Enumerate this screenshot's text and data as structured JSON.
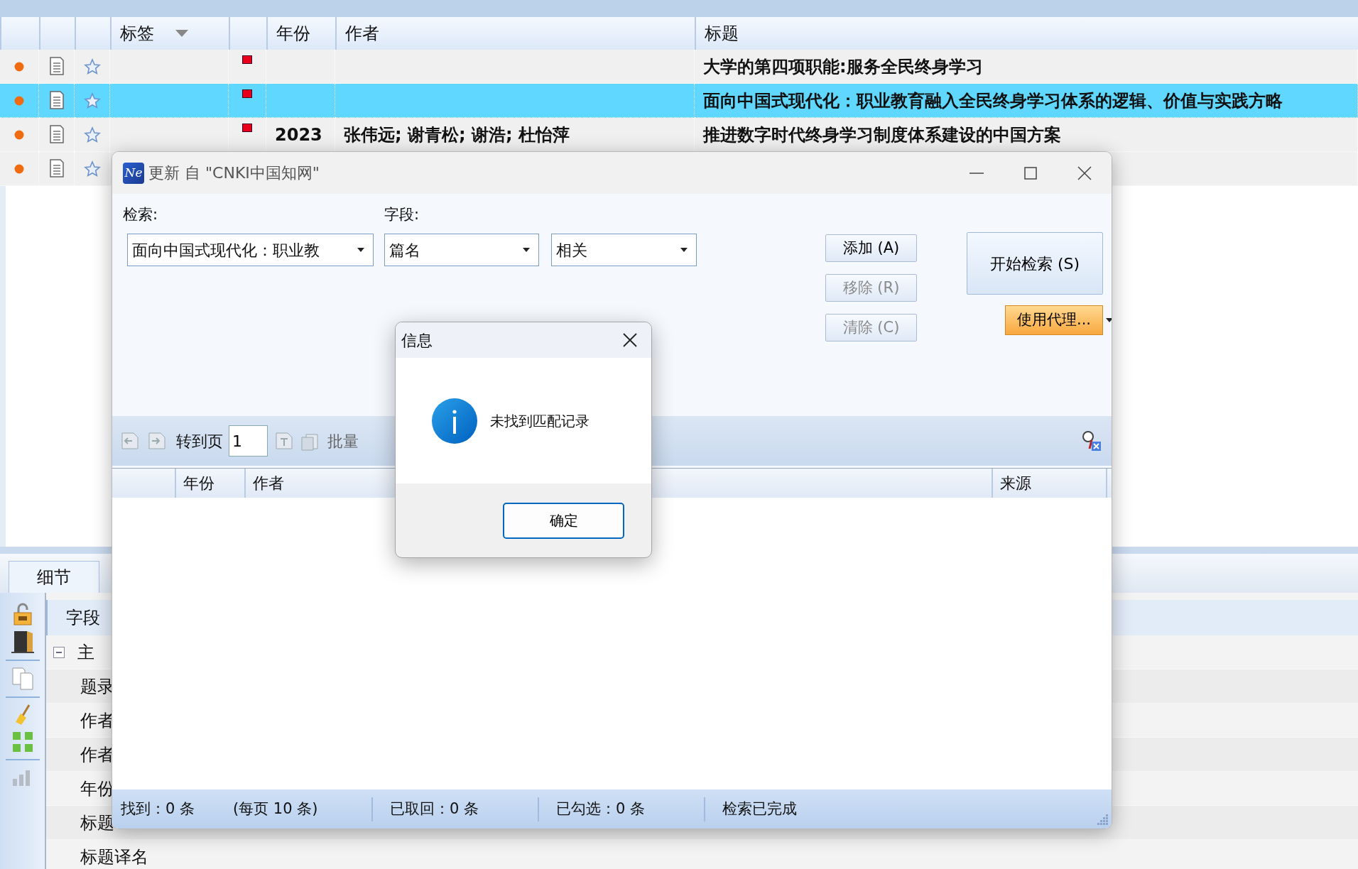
{
  "main_list": {
    "columns": [
      "标签",
      "年份",
      "作者",
      "标题"
    ],
    "rows": [
      {
        "selected": false,
        "flag": true,
        "title": "大学的第四项职能:服务全民终身学习"
      },
      {
        "selected": true,
        "flag": true,
        "title": "面向中国式现代化：职业教育融入全民终身学习体系的逻辑、价值与实践方略"
      },
      {
        "selected": false,
        "flag": true,
        "year": "2023",
        "authors": "张伟远; 谢青松; 谢浩; 杜怡萍",
        "title": "推进数字时代终身学习制度体系建设的中国方案"
      },
      {
        "selected": false
      }
    ]
  },
  "details": {
    "tab": "细节",
    "header": "字段",
    "tree": [
      {
        "label": "主",
        "expanded": true,
        "children": [
          {
            "label": "题录"
          },
          {
            "label": "作者"
          },
          {
            "label": "作者"
          },
          {
            "label": "年份"
          },
          {
            "label": "标题"
          },
          {
            "label": "标题译名"
          }
        ]
      }
    ]
  },
  "search_window": {
    "logo": "Ne",
    "title": "更新 自 \"CNKI中国知网\"",
    "search_label": "检索:",
    "field_label": "字段:",
    "combos": [
      {
        "value": "面向中国式现代化：职业教"
      },
      {
        "value": "篇名"
      },
      {
        "value": "相关"
      }
    ],
    "buttons": [
      {
        "label": "添加 (A)",
        "disabled": false
      },
      {
        "label": "移除 (R)",
        "disabled": true
      },
      {
        "label": "清除 (C)",
        "disabled": true
      }
    ],
    "start_button": "开始检索 (S)",
    "proxy_button": "使用代理...",
    "toolbar": {
      "goto_label": "转到页",
      "page": "1",
      "batch_label": "批量"
    },
    "result_columns": [
      "年份",
      "作者",
      "来源"
    ],
    "status": [
      "找到：0 条",
      "(每页 10 条)",
      "已取回：0 条",
      "已勾选：0 条",
      "检索已完成"
    ]
  },
  "info_dialog": {
    "title": "信息",
    "message": "未找到匹配记录",
    "button": "确定"
  }
}
